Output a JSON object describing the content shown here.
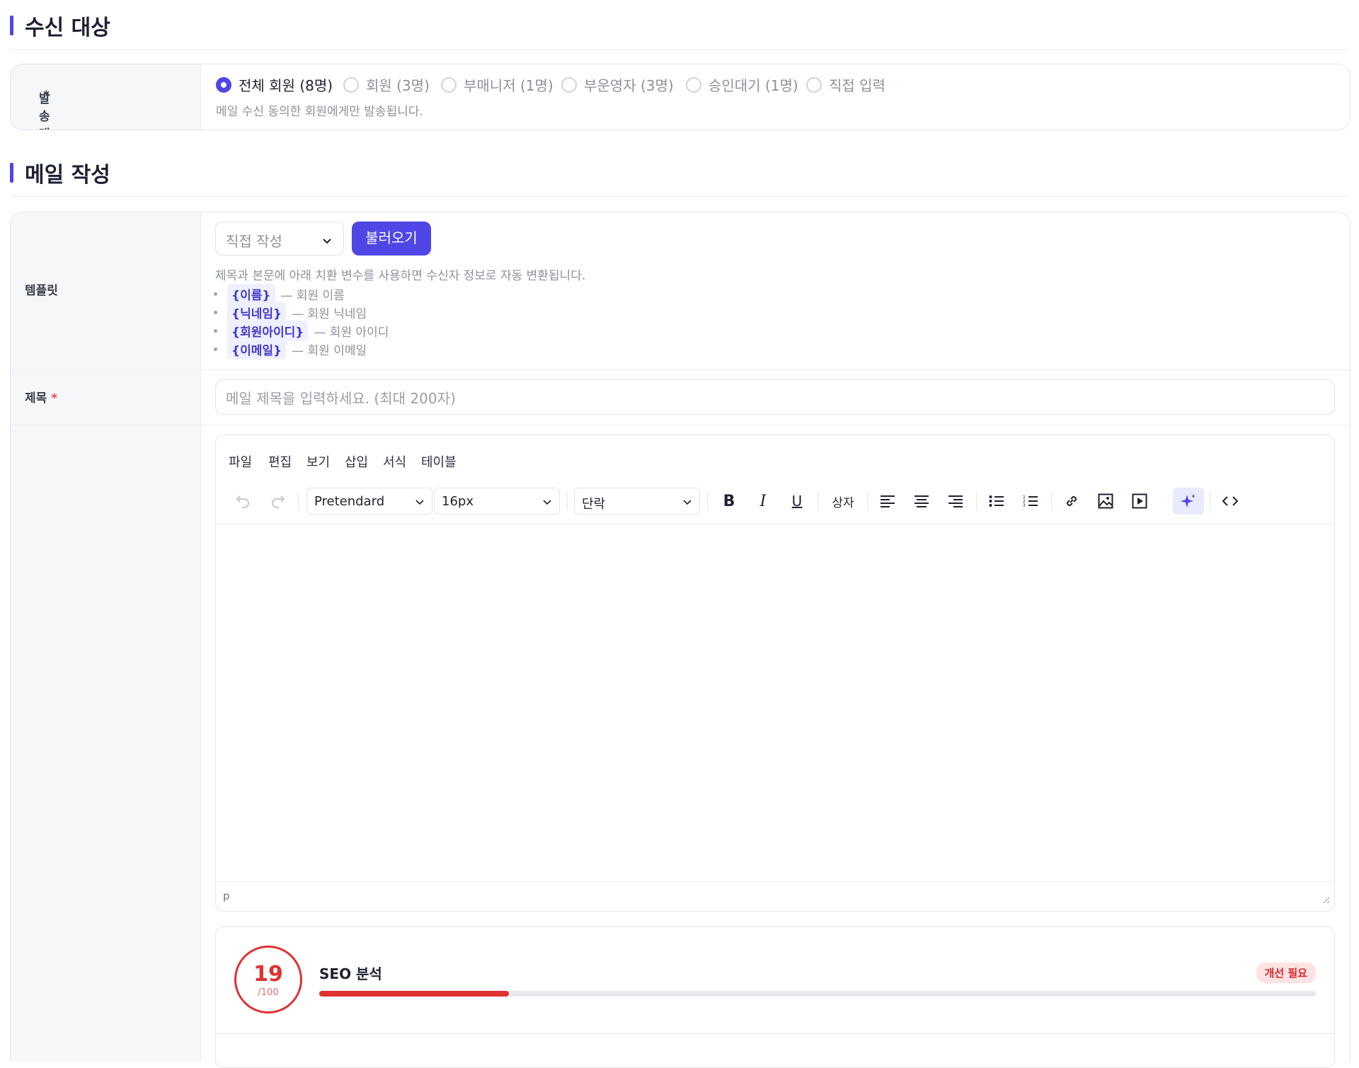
{
  "recipients": {
    "title": "수신 대상",
    "label": "발송 대상",
    "required_mark": "*",
    "options": [
      {
        "label": "전체 회원 (8명)",
        "selected": true
      },
      {
        "label": "회원 (3명)",
        "selected": false
      },
      {
        "label": "부매니저 (1명)",
        "selected": false
      },
      {
        "label": "부운영자 (3명)",
        "selected": false
      },
      {
        "label": "승인대기 (1명)",
        "selected": false
      },
      {
        "label": "직접 입력",
        "selected": false
      }
    ],
    "hint": "메일 수신 동의한 회원에게만 발송됩니다."
  },
  "compose": {
    "title": "메일 작성",
    "template": {
      "label": "템플릿",
      "select_value": "직접 작성",
      "load_button": "불러오기",
      "help": "제목과 본문에 아래 치환 변수를 사용하면 수신자 정보로 자동 변환됩니다.",
      "variables": [
        {
          "token": "{이름}",
          "desc": "— 회원 이름"
        },
        {
          "token": "{닉네임}",
          "desc": "— 회원 닉네임"
        },
        {
          "token": "{회원아이디}",
          "desc": "— 회원 아이디"
        },
        {
          "token": "{이메일}",
          "desc": "— 회원 이메일"
        }
      ]
    },
    "subject": {
      "label": "제목",
      "required_mark": "*",
      "placeholder": "메일 제목을 입력하세요. (최대 200자)"
    },
    "editor": {
      "menus": [
        "파일",
        "편집",
        "보기",
        "삽입",
        "서식",
        "테이블"
      ],
      "font_family": "Pretendard",
      "font_size": "16px",
      "block_format": "단락",
      "toolbar_box_label": "상자",
      "statusbar_path": "p"
    },
    "seo": {
      "score": "19",
      "score_max": "/100",
      "title": "SEO 분석",
      "badge": "개선 필요",
      "progress": 0.19,
      "colors": {
        "accent": "#e03131",
        "primary": "#4f46e5"
      }
    }
  }
}
